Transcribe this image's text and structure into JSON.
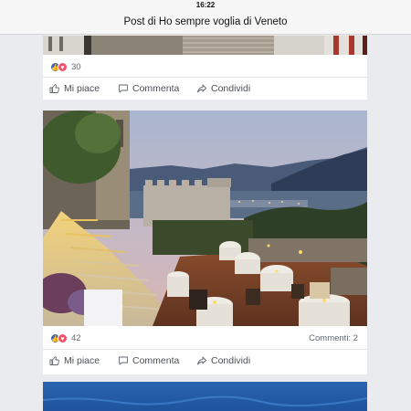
{
  "status_bar": {
    "time": "16:22"
  },
  "header": {
    "title": "Post di Ho sempre voglia di Veneto"
  },
  "posts": [
    {
      "reaction_count": "30",
      "comments": "",
      "actions": {
        "like": "Mi piace",
        "comment": "Commenta",
        "share": "Condividi"
      }
    },
    {
      "reaction_count": "42",
      "comments": "Commenti: 2",
      "actions": {
        "like": "Mi piace",
        "comment": "Commenta",
        "share": "Condividi"
      }
    }
  ],
  "icons": {
    "like_reaction": "thumbs-up-icon",
    "love_reaction": "heart-icon",
    "like_action": "thumbs-up-outline-icon",
    "comment_action": "speech-bubble-icon",
    "share_action": "share-arrow-icon"
  },
  "colors": {
    "like_blue": "#4267b2",
    "love_red": "#f25268",
    "feed_bg": "#e9ebee"
  }
}
